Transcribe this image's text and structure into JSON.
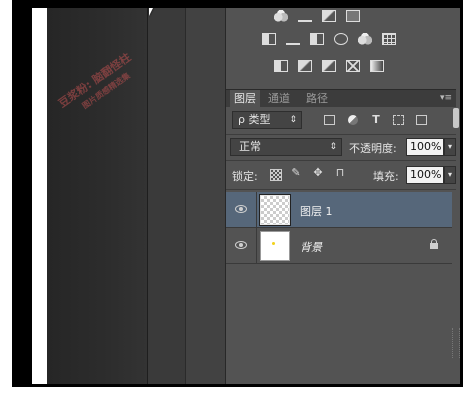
{
  "watermark": {
    "line1": "豆浆粉: 脑翻怪柱",
    "line2": "图片质感精选集"
  },
  "tabs": [
    {
      "label": "图层",
      "active": true
    },
    {
      "label": "通道",
      "active": false
    },
    {
      "label": "路径",
      "active": false
    }
  ],
  "filter": {
    "prefix": "ρ",
    "value": "类型"
  },
  "blend": {
    "value": "正常"
  },
  "opacity": {
    "label": "不透明度:",
    "value": "100%"
  },
  "lock": {
    "label": "锁定:"
  },
  "fill": {
    "label": "填充:",
    "value": "100%"
  },
  "layers": [
    {
      "name": "图层 1",
      "selected": true,
      "thumbnail": "transparent",
      "italic": false,
      "locked": false
    },
    {
      "name": "背景",
      "selected": false,
      "thumbnail": "white",
      "italic": true,
      "locked": true
    }
  ],
  "icons": {
    "adjust_row1": [
      "brightness-icon",
      "levels-icon",
      "curves-icon",
      "exposure-icon"
    ],
    "adjust_row2": [
      "vibrance-icon",
      "balance-icon",
      "bw-icon",
      "photofilter-icon",
      "channelmixer-icon",
      "lookup-icon"
    ],
    "adjust_row3": [
      "invert-icon",
      "posterize-icon",
      "threshold-icon",
      "selectivecolor-icon",
      "gradientmap-icon"
    ],
    "filter": [
      "image-filter-icon",
      "adjustment-filter-icon",
      "type-filter-icon",
      "shape-filter-icon",
      "smartobject-filter-icon"
    ],
    "lock": [
      "lock-pixels-icon",
      "lock-paint-icon",
      "lock-move-icon",
      "lock-all-icon"
    ]
  },
  "colors": {
    "selected_layer": "#56677a",
    "panel": "#535353"
  }
}
